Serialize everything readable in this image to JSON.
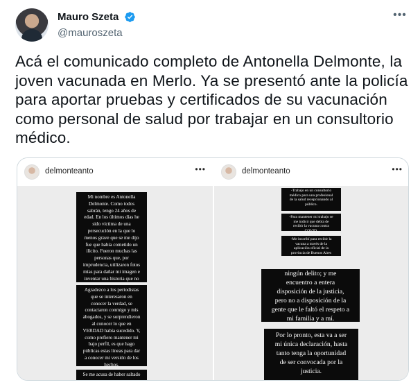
{
  "tweet": {
    "author_name": "Mauro Szeta",
    "author_handle": "@mauroszeta",
    "verified": true,
    "more_label": "•••",
    "text": "Acá el comunicado completo de Antonella Delmonte, la joven vacunada en Merlo. Ya se presentó ante la policía para aportar pruebas y certificados de su vacunación como personal de salud por trabajar en un consultorio médico."
  },
  "colors": {
    "accent": "#1d9bf0",
    "secondary_text": "#536471",
    "story_bg": "#0b0b0b",
    "panel_bg": "#ececec"
  },
  "media": {
    "left": {
      "username": "delmonteanto",
      "more_label": "•••",
      "blocks": [
        "Mi nombre es Antonella\nDelmonte. Como todos\nsabrán, tengo 24 años de\nedad. En los últimos días he\nsido víctima de una\npersecución en la que lo\nmenos grave que se me dijo\nfue que había cometido un\nilícito. Fueron muchas las\npersonas que, por\nimprudencia, utilizaron fotos\nmías para dañar mi imagen e\ninventar una historia que no\nes cierta.",
        "Agradezco a los periodistas\nque se interesaron en\nconocer la verdad, se\ncontactaron conmigo y mis\nabogados, y se sorprendieron\nal conocer lo que en\nVERDAD había sucedido. Y,\ncomo prefiero mantener mi\nbajo perfil, es que hago\npúblicas estas líneas para dar\na conocer mi versión de los\nhechos.",
        "Se me acusa de haber saltado"
      ]
    },
    "right": {
      "username": "delmonteanto",
      "more_label": "•••",
      "small_blocks": [
        "-Trabajo en un consultorio\nmédico para una profesional\nde la salud recepcionando al\npúblico.",
        "-Para mantener mi trabajo se\nme indicó que debía de\nrecibir la vacuna contra\nCOVID.",
        "-Me inscribí para recibir la\nvacuna a través de la\naplicación oficial de la\nprovincia de Buenos Aires"
      ],
      "big_blocks": [
        "ningún delito; y me\nencuentro a entera\ndisposición de la justicia,\npero no a disposición de la\ngente que le faltó el respeto a\nmi familia y a mí.",
        "Por lo pronto, esta va a ser\nmi única declaración, hasta\ntanto tenga la oportunidad\nde ser convocada por la\njusticia."
      ]
    }
  }
}
